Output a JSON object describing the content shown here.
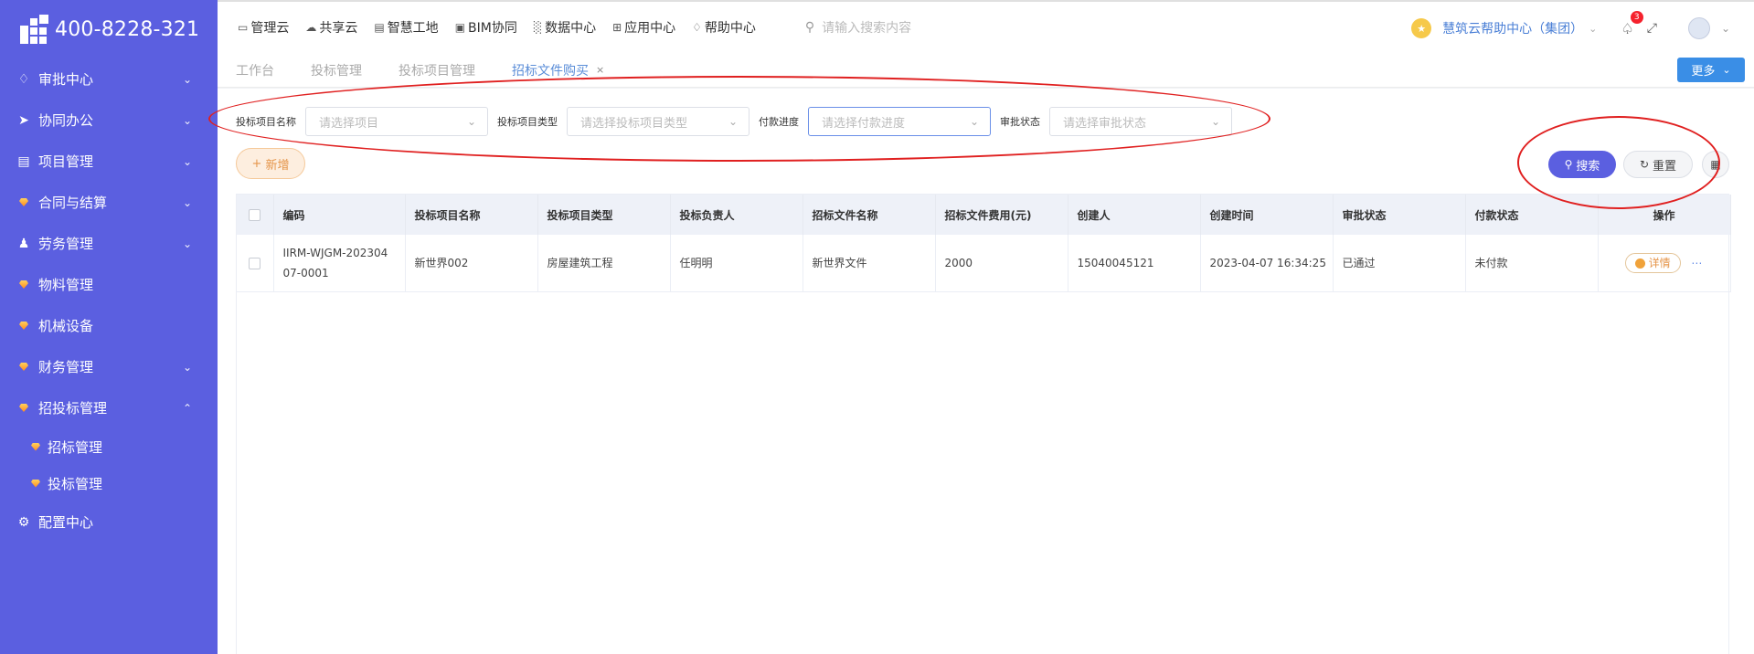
{
  "brand": {
    "phone": "400-8228-321"
  },
  "sidebar": {
    "items": [
      {
        "label": "审批中心",
        "icon": "bell-icon",
        "expandable": true
      },
      {
        "label": "协同办公",
        "icon": "send-icon",
        "expandable": true
      },
      {
        "label": "项目管理",
        "icon": "book-icon",
        "expandable": true
      },
      {
        "label": "合同与结算",
        "icon": "gem-icon",
        "expandable": true
      },
      {
        "label": "劳务管理",
        "icon": "worker-icon",
        "expandable": true
      },
      {
        "label": "物料管理",
        "icon": "gem-icon",
        "expandable": false
      },
      {
        "label": "机械设备",
        "icon": "gem-icon",
        "expandable": false
      },
      {
        "label": "财务管理",
        "icon": "gem-icon",
        "expandable": true
      },
      {
        "label": "招投标管理",
        "icon": "gem-icon",
        "expandable": true,
        "expanded": true
      },
      {
        "label": "招标管理",
        "icon": "gem-icon",
        "sub": true
      },
      {
        "label": "投标管理",
        "icon": "gem-icon",
        "sub": true
      },
      {
        "label": "配置中心",
        "icon": "gear-icon",
        "expandable": false
      }
    ]
  },
  "topnav": {
    "items": [
      {
        "label": "管理云",
        "icon": "doc-icon"
      },
      {
        "label": "共享云",
        "icon": "cloud-icon"
      },
      {
        "label": "智慧工地",
        "icon": "book-icon"
      },
      {
        "label": "BIM协同",
        "icon": "cube-icon"
      },
      {
        "label": "数据中心",
        "icon": "bar-chart-icon"
      },
      {
        "label": "应用中心",
        "icon": "grid-icon"
      },
      {
        "label": "帮助中心",
        "icon": "diamond-icon"
      }
    ],
    "search_placeholder": "请输入搜索内容",
    "org_name": "慧筑云帮助中心（集团）",
    "notification_count": "3"
  },
  "tabs": {
    "items": [
      {
        "label": "工作台"
      },
      {
        "label": "投标管理"
      },
      {
        "label": "投标项目管理"
      },
      {
        "label": "招标文件购买",
        "active": true,
        "close": "×"
      }
    ],
    "more_label": "更多"
  },
  "filters": {
    "fields": [
      {
        "label": "投标项目名称",
        "placeholder": "请选择项目"
      },
      {
        "label": "投标项目类型",
        "placeholder": "请选择投标项目类型"
      },
      {
        "label": "付款进度",
        "placeholder": "请选择付款进度"
      },
      {
        "label": "审批状态",
        "placeholder": "请选择审批状态"
      }
    ]
  },
  "actions": {
    "add_label": "新增",
    "search_label": "搜索",
    "reset_label": "重置"
  },
  "table": {
    "columns": [
      "编码",
      "投标项目名称",
      "投标项目类型",
      "投标负责人",
      "招标文件名称",
      "招标文件费用(元)",
      "创建人",
      "创建时间",
      "审批状态",
      "付款状态",
      "操作"
    ],
    "rows": [
      {
        "code_line1": "IIRM-WJGM-202304",
        "code_line2": "07-0001",
        "project_name": "新世界002",
        "project_type": "房屋建筑工程",
        "owner": "任明明",
        "file_name": "新世界文件",
        "fee": "2000",
        "creator": "15040045121",
        "created_at": "2023-04-07 16:34:25",
        "approval_status": "已通过",
        "payment_status": "未付款",
        "detail_label": "详情"
      }
    ]
  },
  "colors": {
    "sidebar_bg": "#5b5fe0",
    "primary": "#5b5fe0",
    "blue_button": "#3a8ee6",
    "annotation_red": "#e02020"
  }
}
